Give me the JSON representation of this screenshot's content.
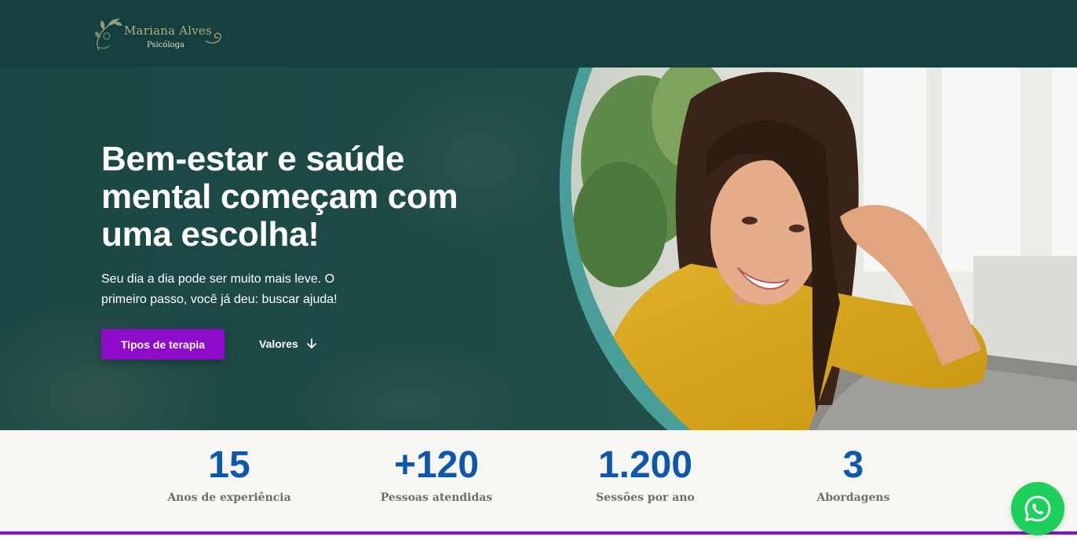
{
  "brand": {
    "name": "Mariana Alves",
    "subtitle": "Psicóloga"
  },
  "hero": {
    "headline": "Bem-estar e saúde mental começam com uma escolha!",
    "subtext": "Seu dia a dia pode ser muito mais leve. O primeiro passo, você já deu: buscar ajuda!",
    "primary_button": "Tipos de terapia",
    "secondary_link": "Valores",
    "secondary_icon": "arrow-down-icon"
  },
  "stats": [
    {
      "value": "15",
      "label": "Anos de experiência"
    },
    {
      "value": "+120",
      "label": "Pessoas atendidas"
    },
    {
      "value": "1.200",
      "label": "Sessões por ano"
    },
    {
      "value": "3",
      "label": "Abordagens"
    }
  ],
  "floating": {
    "whatsapp_icon": "whatsapp-icon"
  },
  "colors": {
    "header_bg": "#163f3f",
    "accent_purple": "#8d0bc9",
    "stat_blue": "#0d57ad",
    "teal_arc": "#4a9e99",
    "whatsapp_green": "#1dd05c"
  }
}
